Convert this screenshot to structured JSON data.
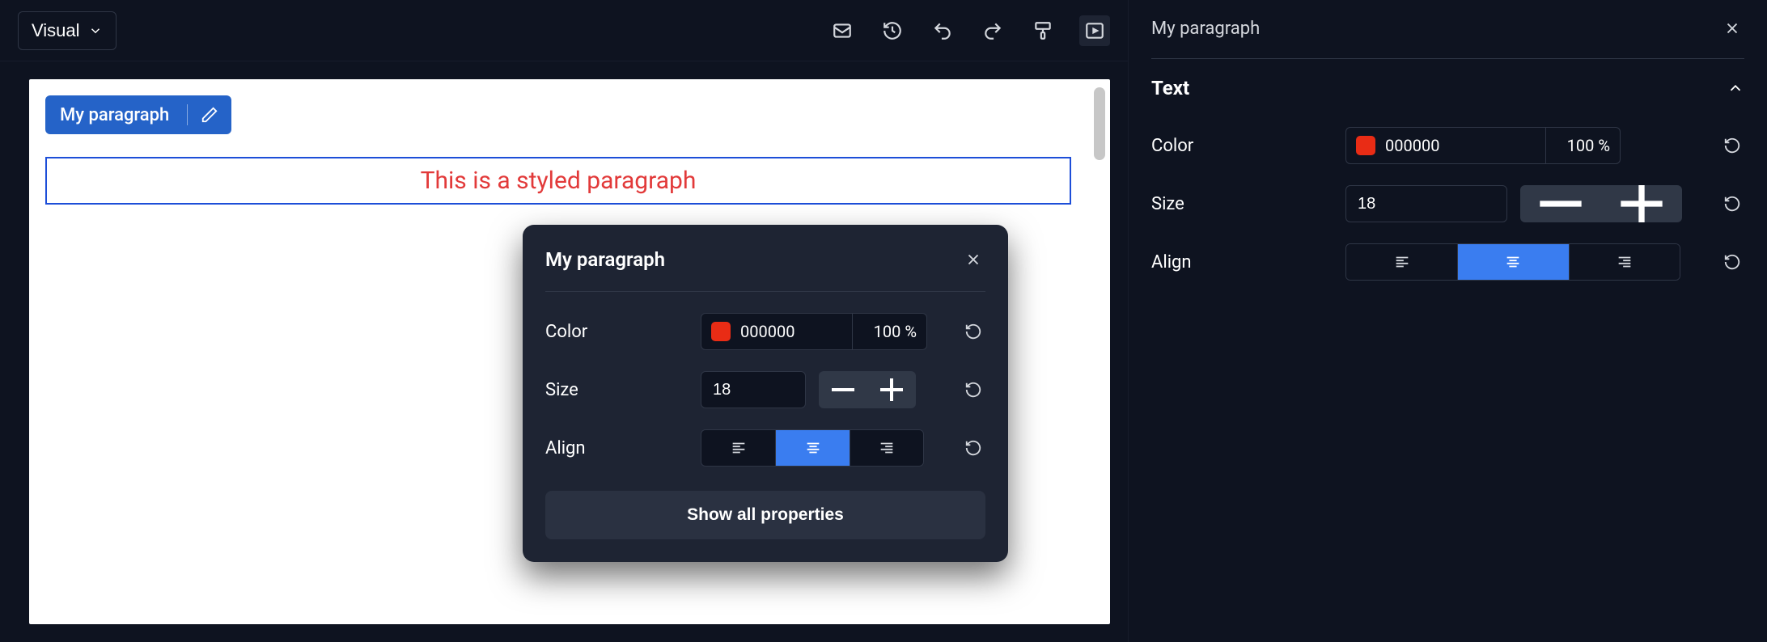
{
  "toolbar": {
    "mode_label": "Visual"
  },
  "selection": {
    "chip_label": "My paragraph",
    "paragraph_text": "This is a styled paragraph"
  },
  "popover": {
    "title": "My paragraph",
    "props": {
      "color_label": "Color",
      "color_hex": "000000",
      "color_opacity": "100 %",
      "size_label": "Size",
      "size_value": "18",
      "align_label": "Align",
      "align_selected": "center"
    },
    "show_all_label": "Show all properties"
  },
  "sidebar": {
    "title": "My paragraph",
    "section_label": "Text",
    "props": {
      "color_label": "Color",
      "color_hex": "000000",
      "color_opacity": "100 %",
      "size_label": "Size",
      "size_value": "18",
      "align_label": "Align",
      "align_selected": "center"
    }
  },
  "colors": {
    "swatch": "#e92c15",
    "paragraph_text": "#e23a3a",
    "selection_border": "#1d4ed8",
    "accent": "#2563c8"
  }
}
